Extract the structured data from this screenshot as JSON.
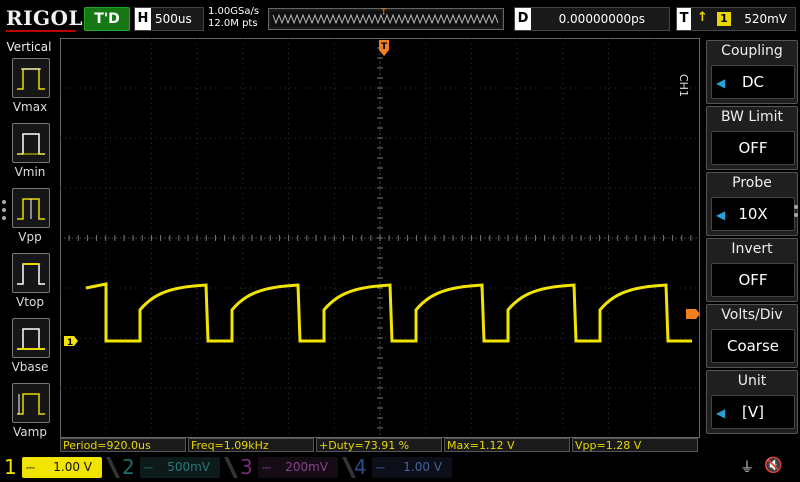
{
  "topbar": {
    "brand": "RIGOL",
    "run_status": "T'D",
    "horizontal_label": "H",
    "timebase": "500us",
    "sample_rate": "1.00GSa/s",
    "memory_depth": "12.0M pts",
    "trigger_marker": "T",
    "delay_label": "D",
    "delay_value": "0.00000000ps",
    "trigger_label": "T",
    "trigger_edge_icon": "rising-edge-icon",
    "trigger_source": "1",
    "trigger_level": "520mV"
  },
  "left_panel": {
    "title": "Vertical",
    "items": [
      {
        "label": "Vmax",
        "icon": "vmax-icon"
      },
      {
        "label": "Vmin",
        "icon": "vmin-icon"
      },
      {
        "label": "Vpp",
        "icon": "vpp-icon"
      },
      {
        "label": "Vtop",
        "icon": "vtop-icon"
      },
      {
        "label": "Vbase",
        "icon": "vbase-icon"
      },
      {
        "label": "Vamp",
        "icon": "vamp-icon"
      }
    ]
  },
  "screen": {
    "channel_marker": "1",
    "trace_color": "#f1e400",
    "trigger_color": "#f08020"
  },
  "right_menu": {
    "channel_tag": "CH1",
    "items": [
      {
        "title": "Coupling",
        "value": "DC"
      },
      {
        "title": "BW Limit",
        "value": "OFF"
      },
      {
        "title": "Probe",
        "value": "10X"
      },
      {
        "title": "Invert",
        "value": "OFF"
      },
      {
        "title": "Volts/Div",
        "value": "Coarse"
      },
      {
        "title": "Unit",
        "value": "[V]"
      }
    ]
  },
  "measurements": [
    "Period=920.0us",
    "Freq=1.09kHz",
    "+Duty=73.91 %",
    "Max=1.12 V",
    "Vpp=1.28 V"
  ],
  "channels": [
    {
      "num": "1",
      "scale": "1.00 V",
      "active": true,
      "color": "#f1e400"
    },
    {
      "num": "2",
      "scale": "500mV",
      "active": false,
      "color": "#1a6d6d"
    },
    {
      "num": "3",
      "scale": "200mV",
      "active": false,
      "color": "#7a2b7a"
    },
    {
      "num": "4",
      "scale": "1.00 V",
      "active": false,
      "color": "#2b4e8a"
    }
  ],
  "status_icons": [
    "usb-icon",
    "speaker-muted-icon"
  ]
}
